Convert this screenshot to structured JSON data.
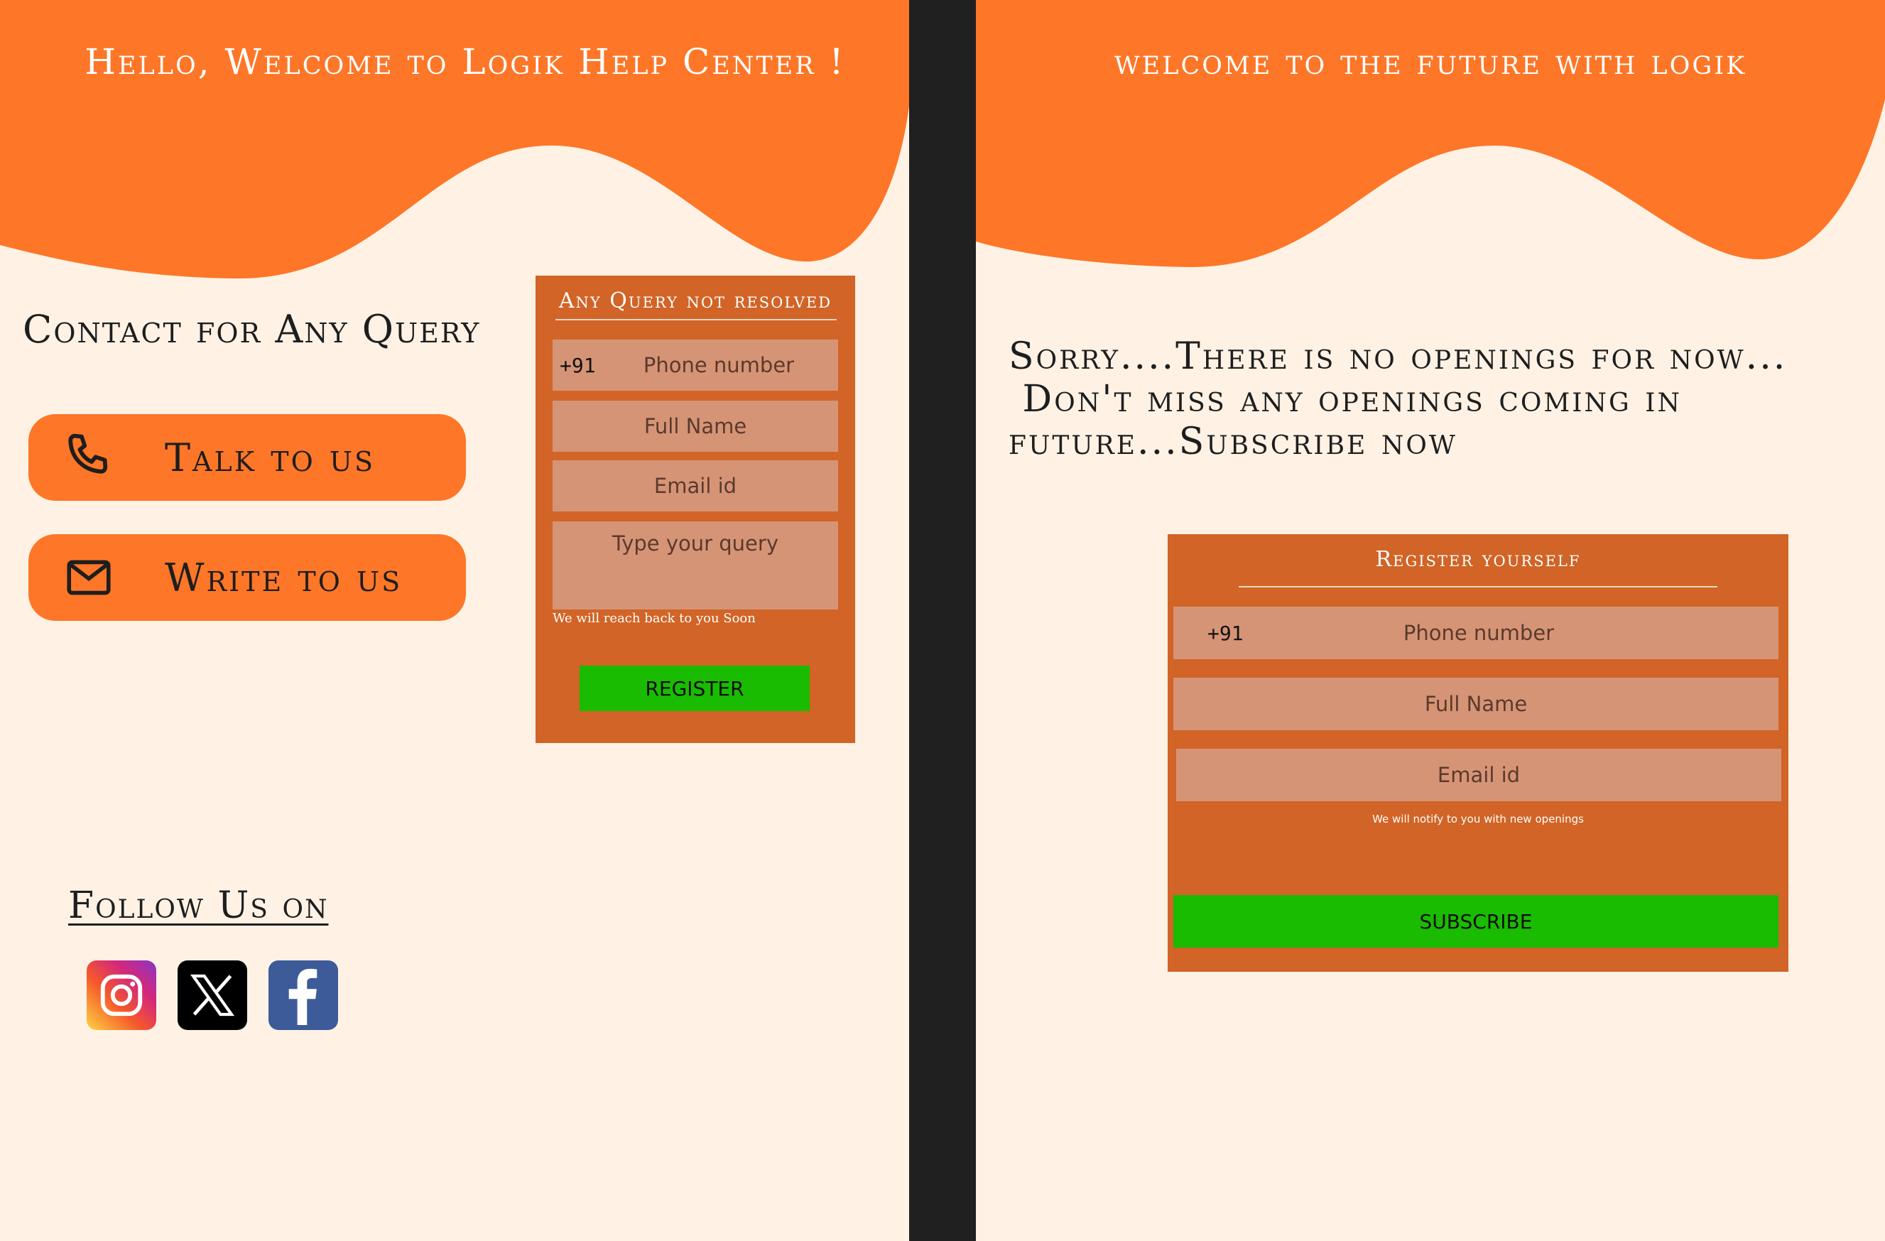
{
  "colors": {
    "accent": "#fe7627",
    "form_bg": "#d16426",
    "field_bg": "#d69476",
    "button_green": "#19bc00",
    "page_bg": "#fff2e5",
    "divider": "#202020"
  },
  "help_center": {
    "title": "Hello, Welcome to Logik Help Center !",
    "contact_heading": "Contact for Any Query",
    "talk_label": "Talk to us",
    "talk_icon": "phone-icon",
    "write_label": "Write to us",
    "write_icon": "mail-icon",
    "follow_heading": "Follow Us on",
    "socials": [
      "instagram-icon",
      "x-icon",
      "facebook-icon"
    ],
    "query_form": {
      "title": "Any Query not resolved",
      "country_code": "+91",
      "phone_placeholder": "Phone number",
      "name_placeholder": "Full Name",
      "email_placeholder": "Email id",
      "query_placeholder": "Type your query",
      "note": "We will reach back to you Soon",
      "button": "REGISTER"
    }
  },
  "careers": {
    "title": "welcome to the future with logik",
    "message_line1": "Sorry....There is no openings for now...",
    "message_line2": " Don't miss any openings coming in",
    "message_line3": "future...Subscribe now",
    "register_form": {
      "title": "Register yourself",
      "country_code": "+91",
      "phone_placeholder": "Phone number",
      "name_placeholder": "Full Name",
      "email_placeholder": "Email id",
      "note": "We will notify to you with new openings",
      "button": "SUBSCRIBE"
    }
  }
}
